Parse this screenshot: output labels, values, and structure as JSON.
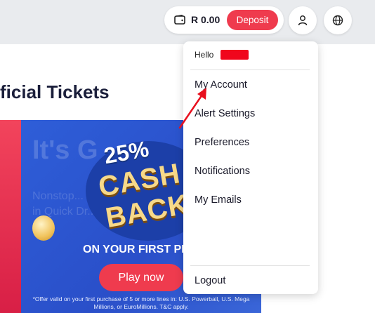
{
  "header": {
    "balance": "R 0.00",
    "deposit_label": "Deposit"
  },
  "page": {
    "heading": "ficial Tickets"
  },
  "banner": {
    "ghost_title": "It's G",
    "ghost_text": "Nonstop... hear with... in Quick Dr...",
    "percent": "25%",
    "cash": "CASH",
    "back": "BACK",
    "subtitle": "ON YOUR FIRST PI",
    "cta": "Play now",
    "fineprint": "*Offer valid on your first purchase of 5 or more lines in: U.S. Powerball, U.S. Mega Millions, or EuroMillions. T&C apply."
  },
  "account_menu": {
    "greeting": "Hello",
    "items": [
      "My Account",
      "Alert Settings",
      "Preferences",
      "Notifications",
      "My Emails"
    ],
    "logout": "Logout"
  },
  "colors": {
    "accent": "#ef3b4e",
    "annotation": "#e8101e",
    "banner_blue": "#2e5ed8"
  }
}
